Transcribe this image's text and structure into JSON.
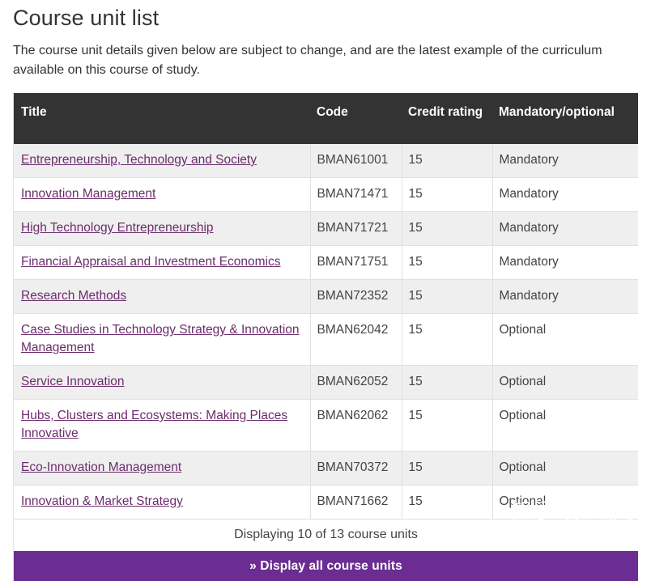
{
  "page": {
    "title": "Course unit list",
    "intro": "The course unit details given below are subject to change, and are the latest example of the curriculum available on this course of study."
  },
  "table": {
    "headers": {
      "title": "Title",
      "code": "Code",
      "credit": "Credit rating",
      "mandatory": "Mandatory/optional"
    },
    "rows": [
      {
        "title": "Entrepreneurship, Technology and Society",
        "code": "BMAN61001",
        "credit": "15",
        "mandatory": "Mandatory"
      },
      {
        "title": "Innovation Management",
        "code": "BMAN71471",
        "credit": "15",
        "mandatory": "Mandatory"
      },
      {
        "title": "High Technology Entrepreneurship",
        "code": "BMAN71721",
        "credit": "15",
        "mandatory": "Mandatory"
      },
      {
        "title": "Financial Appraisal and Investment Economics",
        "code": "BMAN71751",
        "credit": "15",
        "mandatory": "Mandatory"
      },
      {
        "title": "Research Methods",
        "code": "BMAN72352",
        "credit": "15",
        "mandatory": "Mandatory"
      },
      {
        "title": "Case Studies in Technology Strategy & Innovation Management",
        "code": "BMAN62042",
        "credit": "15",
        "mandatory": "Optional"
      },
      {
        "title": "Service Innovation",
        "code": "BMAN62052",
        "credit": "15",
        "mandatory": "Optional"
      },
      {
        "title": "Hubs, Clusters and Ecosystems: Making Places Innovative",
        "code": "BMAN62062",
        "credit": "15",
        "mandatory": "Optional"
      },
      {
        "title": "Eco-Innovation Management",
        "code": "BMAN70372",
        "credit": "15",
        "mandatory": "Optional"
      },
      {
        "title": "Innovation & Market Strategy",
        "code": "BMAN71662",
        "credit": "15",
        "mandatory": "Optional"
      }
    ],
    "footer_count": "Displaying 10 of 13 course units"
  },
  "actions": {
    "display_all": "» Display all course units"
  },
  "watermark": {
    "text": "知乎 @八秒灵"
  },
  "colors": {
    "header_bg": "#333333",
    "accent_purple": "#6b2d91",
    "link_purple": "#6b2d6b",
    "row_alt_bg": "#efefef"
  }
}
